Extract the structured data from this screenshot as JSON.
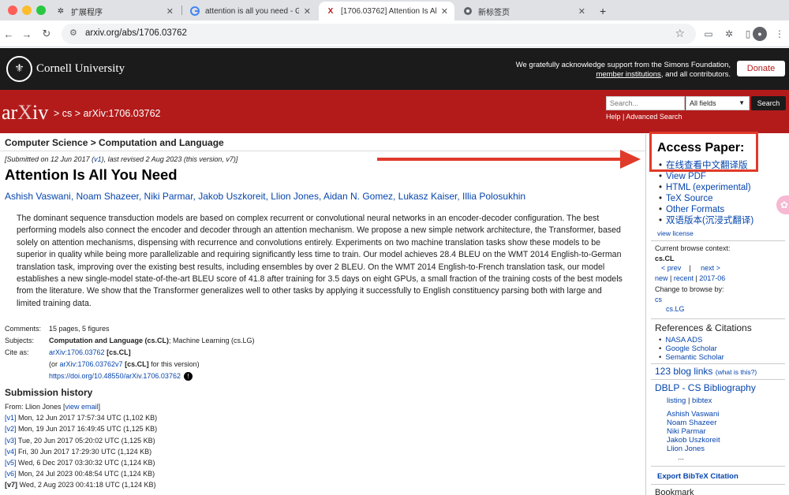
{
  "browser": {
    "tabs": [
      {
        "label": "扩展程序",
        "icon": "puzzle-icon"
      },
      {
        "label": "attention is all you need - Goo",
        "icon": "google-icon"
      },
      {
        "label": "[1706.03762] Attention Is All Y",
        "icon": "arxiv-icon"
      },
      {
        "label": "新标签页",
        "icon": "chrome-icon"
      }
    ],
    "new_tab": "+",
    "url": "arxiv.org/abs/1706.03762"
  },
  "cornell": {
    "name": "Cornell University",
    "ack_line1": "We gratefully acknowledge support from the Simons Foundation,",
    "ack_link": "member institutions",
    "ack_line2_rest": ", and all contributors.",
    "donate": "Donate"
  },
  "arxiv_header": {
    "logo_ar": "ar",
    "logo_x": "X",
    "logo_iv": "iv",
    "breadcrumb": "> cs > arXiv:1706.03762",
    "search_placeholder": "Search...",
    "search_field": "All fields",
    "search_button": "Search",
    "help": "Help",
    "advanced": "Advanced Search"
  },
  "subject_bar": "Computer Science > Computation and Language",
  "submitted": {
    "prefix": "[Submitted on 12 Jun 2017 (",
    "v1": "v1",
    "suffix": "), last revised 2 Aug 2023 (this version, v7)]"
  },
  "title": "Attention Is All You Need",
  "authors": "Ashish Vaswani, Noam Shazeer, Niki Parmar, Jakob Uszkoreit, Llion Jones, Aidan N. Gomez, Lukasz Kaiser, Illia Polosukhin",
  "abstract": "The dominant sequence transduction models are based on complex recurrent or convolutional neural networks in an encoder-decoder configuration. The best performing models also connect the encoder and decoder through an attention mechanism. We propose a new simple network architecture, the Transformer, based solely on attention mechanisms, dispensing with recurrence and convolutions entirely. Experiments on two machine translation tasks show these models to be superior in quality while being more parallelizable and requiring significantly less time to train. Our model achieves 28.4 BLEU on the WMT 2014 English-to-German translation task, improving over the existing best results, including ensembles by over 2 BLEU. On the WMT 2014 English-to-French translation task, our model establishes a new single-model state-of-the-art BLEU score of 41.8 after training for 3.5 days on eight GPUs, a small fraction of the training costs of the best models from the literature. We show that the Transformer generalizes well to other tasks by applying it successfully to English constituency parsing both with large and limited training data.",
  "meta": {
    "comments_label": "Comments:",
    "comments": "15 pages, 5 figures",
    "subjects_label": "Subjects:",
    "subjects_bold": "Computation and Language (cs.CL)",
    "subjects_rest": "; Machine Learning (cs.LG)",
    "cite_label": "Cite as:",
    "cite_link": "arXiv:1706.03762",
    "cite_tag": "[cs.CL]",
    "cite2_prefix": "(or ",
    "cite2_link": "arXiv:1706.03762v7",
    "cite2_tag": "[cs.CL]",
    "cite2_suffix": " for this version)",
    "doi": "https://doi.org/10.48550/arXiv.1706.03762"
  },
  "history": {
    "title": "Submission history",
    "from_prefix": "From: Llion Jones [",
    "view_email": "view email",
    "from_suffix": "]",
    "versions": [
      {
        "v": "[v1]",
        "text": " Mon, 12 Jun 2017 17:57:34 UTC (1,102 KB)"
      },
      {
        "v": "[v2]",
        "text": " Mon, 19 Jun 2017 16:49:45 UTC (1,125 KB)"
      },
      {
        "v": "[v3]",
        "text": " Tue, 20 Jun 2017 05:20:02 UTC (1,125 KB)"
      },
      {
        "v": "[v4]",
        "text": " Fri, 30 Jun 2017 17:29:30 UTC (1,124 KB)"
      },
      {
        "v": "[v5]",
        "text": " Wed, 6 Dec 2017 03:30:32 UTC (1,124 KB)"
      },
      {
        "v": "[v6]",
        "text": " Mon, 24 Jul 2023 00:48:54 UTC (1,124 KB)"
      },
      {
        "v": "[v7]",
        "text": " Wed, 2 Aug 2023 00:41:18 UTC (1,124 KB)"
      }
    ]
  },
  "sidebar": {
    "access_title": "Access Paper:",
    "access_items": [
      "在线查看中文翻译版",
      "View PDF",
      "HTML (experimental)",
      "TeX Source",
      "Other Formats",
      "双语版本(沉浸式翻译)"
    ],
    "view_license": "view license",
    "context_label": "Current browse context:",
    "context_value": "cs.CL",
    "prev": "< prev",
    "sep": "|",
    "next": "next >",
    "new": "new",
    "recent": "recent",
    "date": "2017-06",
    "change_label": "Change to browse by:",
    "browse_cs": "cs",
    "browse_cslg": "cs.LG",
    "refs_title": "References & Citations",
    "refs": [
      "NASA ADS",
      "Google Scholar",
      "Semantic Scholar"
    ],
    "blog_count": "123 blog links",
    "blog_what": "(what is this?)",
    "dblp_title": "DBLP - CS Bibliography",
    "dblp_listing": "listing",
    "dblp_bibtex": "bibtex",
    "dblp_authors": [
      "Ashish Vaswani",
      "Noam Shazeer",
      "Niki Parmar",
      "Jakob Uszkoreit",
      "Llion Jones",
      "..."
    ],
    "export_bibtex": "Export BibTeX Citation",
    "bookmark": "Bookmark"
  },
  "colors": {
    "arxiv_red": "#b31b1b",
    "annotation_red": "#e03a2a",
    "link_blue": "#0645ad"
  }
}
